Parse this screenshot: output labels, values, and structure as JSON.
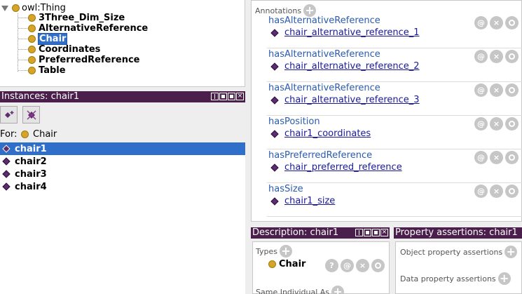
{
  "class_tree": {
    "root": "owl:Thing",
    "items": [
      {
        "label": "3Three_Dim_Size",
        "selected": false
      },
      {
        "label": "AlternativeReference",
        "selected": false
      },
      {
        "label": "Chair",
        "selected": true
      },
      {
        "label": "Coordinates",
        "selected": false
      },
      {
        "label": "PreferredReference",
        "selected": false
      },
      {
        "label": "Table",
        "selected": false
      }
    ]
  },
  "instances": {
    "title": "Instances: chair1",
    "for_label": "For:",
    "for_class": "Chair",
    "items": [
      {
        "label": "chair1",
        "selected": true
      },
      {
        "label": "chair2",
        "selected": false
      },
      {
        "label": "chair3",
        "selected": false
      },
      {
        "label": "chair4",
        "selected": false
      }
    ]
  },
  "annotations": {
    "title": "Annotations",
    "rows": [
      {
        "property": "hasAlternativeReference",
        "value": "chair_alternative_reference_1"
      },
      {
        "property": "hasAlternativeReference",
        "value": "chair_alternative_reference_2"
      },
      {
        "property": "hasAlternativeReference",
        "value": "chair_alternative_reference_3"
      },
      {
        "property": "hasPosition",
        "value": "chair1_coordinates"
      },
      {
        "property": "hasPreferredReference",
        "value": "chair_preferred_reference"
      },
      {
        "property": "hasSize",
        "value": "chair1_size"
      }
    ]
  },
  "description": {
    "title": "Description: chair1",
    "types_label": "Types",
    "type_value": "Chair",
    "same_individual_label": "Same Individual As"
  },
  "property_assertions": {
    "title": "Property assertions: chair1",
    "object_label": "Object property assertions",
    "data_label": "Data property assertions"
  },
  "icons": {
    "plus": "+",
    "at": "@",
    "close": "×",
    "help": "?"
  },
  "colors": {
    "header": "#4b1f4b",
    "selection": "#2f6fc9",
    "class_dot": "#d6a526",
    "individual": "#5b2d6e",
    "property_link": "#2a5bb0"
  }
}
